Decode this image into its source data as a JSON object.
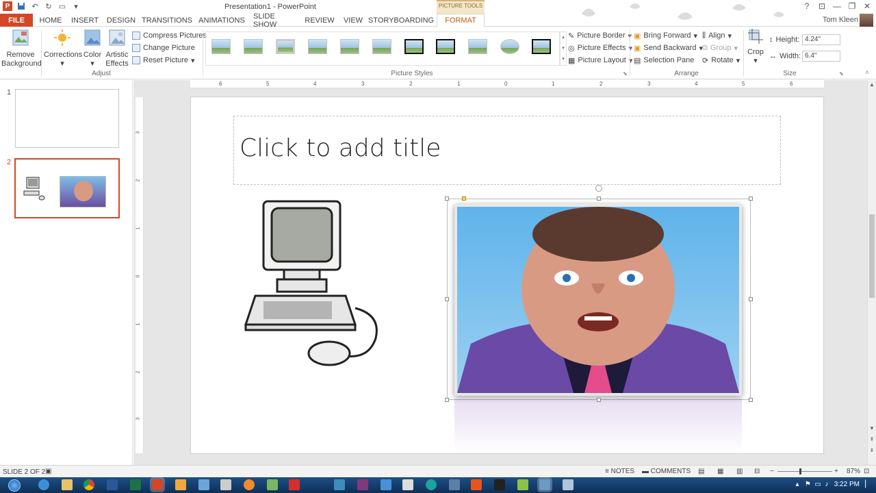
{
  "window": {
    "title": "Presentation1 - PowerPoint",
    "min": "—",
    "restore": "❐",
    "close": "✕",
    "help": "?"
  },
  "qat": {
    "app_icon": "P"
  },
  "tabs": {
    "file": "FILE",
    "home": "HOME",
    "insert": "INSERT",
    "design": "DESIGN",
    "transitions": "TRANSITIONS",
    "animations": "ANIMATIONS",
    "slideshow": "SLIDE SHOW",
    "review": "REVIEW",
    "view": "VIEW",
    "storyboarding": "STORYBOARDING",
    "format": "FORMAT",
    "context_group": "PICTURE TOOLS"
  },
  "user": {
    "name": "Tom Kleen"
  },
  "ribbon": {
    "remove_bg_1": "Remove",
    "remove_bg_2": "Background",
    "corrections": "Corrections",
    "color": "Color",
    "artistic_1": "Artistic",
    "artistic_2": "Effects",
    "compress": "Compress Pictures",
    "change": "Change Picture",
    "reset": "Reset Picture",
    "adjust_label": "Adjust",
    "styles_label": "Picture Styles",
    "border": "Picture Border",
    "effects": "Picture Effects",
    "layout": "Picture Layout",
    "bring_forward": "Bring Forward",
    "send_backward": "Send Backward",
    "selection_pane": "Selection Pane",
    "align": "Align",
    "group": "Group",
    "rotate": "Rotate",
    "arrange_label": "Arrange",
    "crop": "Crop",
    "height_label": "Height:",
    "height_value": "4.24\"",
    "width_label": "Width:",
    "width_value": "6.4\"",
    "size_label": "Size"
  },
  "slides_panel": {
    "slide1": "1",
    "slide2": "2"
  },
  "slide": {
    "title_placeholder": "Click to add title"
  },
  "ruler": {
    "h": [
      "6",
      "5",
      "4",
      "3",
      "2",
      "1",
      "0",
      "1",
      "2",
      "3",
      "4",
      "5",
      "6"
    ],
    "v": [
      "3",
      "2",
      "1",
      "0",
      "1",
      "2",
      "3"
    ]
  },
  "status": {
    "slide_info": "SLIDE 2 OF 2",
    "notes": "NOTES",
    "comments": "COMMENTS",
    "zoom_minus": "−",
    "zoom_plus": "+",
    "zoom": "87%"
  },
  "taskbar": {
    "time": "3:22 PM"
  },
  "colors": {
    "accent": "#d24726",
    "format_tab": "#c55a11",
    "taskbar": "#1d4f86"
  }
}
